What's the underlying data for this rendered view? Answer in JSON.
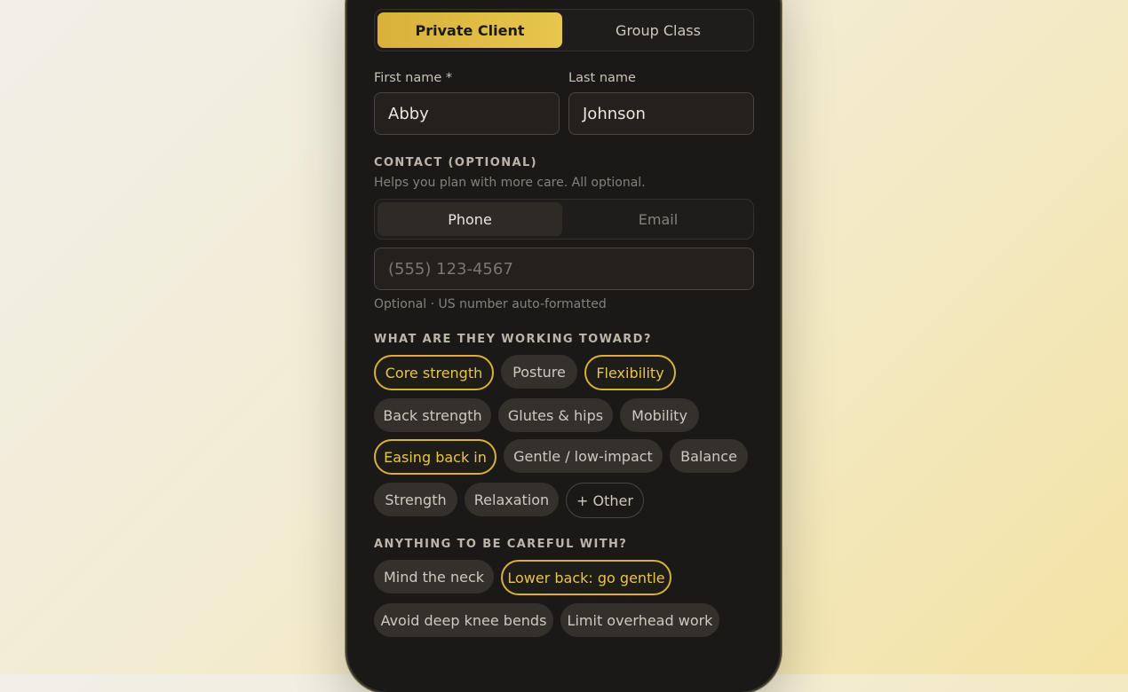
{
  "client_type": {
    "options": [
      "Private Client",
      "Group Class"
    ],
    "selected": "Private Client"
  },
  "name": {
    "first_label": "First name *",
    "first_value": "Abby",
    "last_label": "Last name",
    "last_value": "Johnson"
  },
  "contact": {
    "title": "CONTACT (OPTIONAL)",
    "subtitle": "Helps you plan with more care. All optional.",
    "methods": [
      "Phone",
      "Email"
    ],
    "selected_method": "Phone",
    "phone_placeholder": "(555) 123-4567",
    "phone_hint": "Optional · US number auto-formatted"
  },
  "goals": {
    "title": "WHAT ARE THEY WORKING TOWARD?",
    "chips": [
      {
        "label": "Core strength",
        "selected": true
      },
      {
        "label": "Posture",
        "selected": false
      },
      {
        "label": "Flexibility",
        "selected": true
      },
      {
        "label": "Back strength",
        "selected": false
      },
      {
        "label": "Glutes & hips",
        "selected": false
      },
      {
        "label": "Mobility",
        "selected": false
      },
      {
        "label": "Easing back in",
        "selected": true
      },
      {
        "label": "Gentle / low-impact",
        "selected": false
      },
      {
        "label": "Balance",
        "selected": false
      },
      {
        "label": "Strength",
        "selected": false
      },
      {
        "label": "Relaxation",
        "selected": false
      }
    ],
    "other_label": "+ Other"
  },
  "cautions": {
    "title": "ANYTHING TO BE CAREFUL WITH?",
    "chips": [
      {
        "label": "Mind the neck",
        "selected": false
      },
      {
        "label": "Lower back: go gentle",
        "selected": true
      },
      {
        "label": "Avoid deep knee bends",
        "selected": false
      },
      {
        "label": "Limit overhead work",
        "selected": false
      }
    ]
  },
  "colors": {
    "accent": "#d8b13a",
    "panel": "#1b1917"
  }
}
